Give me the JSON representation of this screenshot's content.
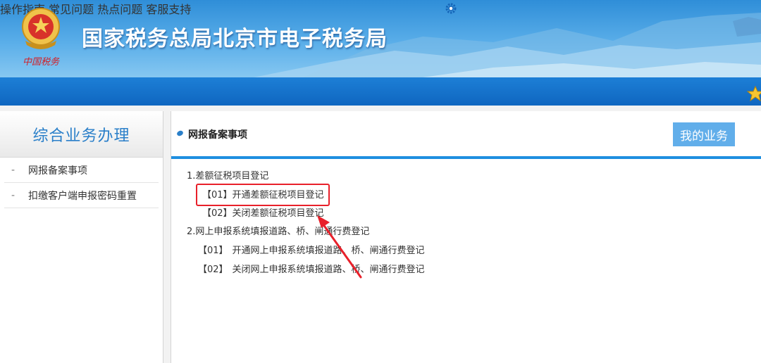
{
  "header": {
    "emblem_caption": "中国税务",
    "site_title": "国家税务总局北京市电子税务局",
    "nav": [
      {
        "label": "操作指南"
      },
      {
        "label": "常见问题"
      },
      {
        "label": "热点问题"
      },
      {
        "label": "客服支持"
      }
    ]
  },
  "sidebar": {
    "title": "综合业务办理",
    "items": [
      {
        "label": "网报备案事项"
      },
      {
        "label": "扣缴客户端申报密码重置"
      }
    ]
  },
  "main": {
    "title": "网报备案事项",
    "my_business_button": "我的业务",
    "sections": [
      {
        "label": "1.差额征税项目登记",
        "items": [
          {
            "code": "【01】",
            "label": "开通差额征税项目登记"
          },
          {
            "code": "【02】",
            "label": "关闭差额征税项目登记"
          }
        ]
      },
      {
        "label": "2.网上申报系统填报道路、桥、闸通行费登记",
        "items": [
          {
            "code": "【01】",
            "label": "开通网上申报系统填报道路、桥、闸通行费登记"
          },
          {
            "code": "【02】",
            "label": "关闭网上申报系统填报道路、桥、闸通行费登记"
          }
        ]
      }
    ]
  },
  "colors": {
    "accent": "#2a7fc9",
    "banner_blue": "#0f66c0",
    "annotation_red": "#e8202a"
  }
}
